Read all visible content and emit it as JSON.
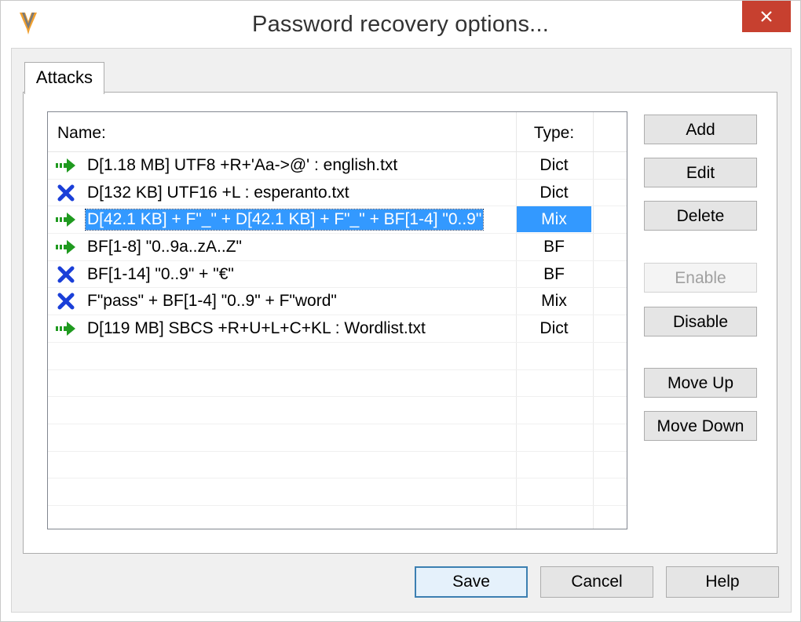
{
  "window": {
    "title": "Password recovery options..."
  },
  "tabs": [
    {
      "label": "Attacks"
    }
  ],
  "list": {
    "columns": {
      "name": "Name:",
      "type": "Type:"
    },
    "rows": [
      {
        "status": "enabled",
        "name": "D[1.18 MB]  UTF8 +R+'Aa->@' : english.txt",
        "type": "Dict",
        "selected": false
      },
      {
        "status": "disabled",
        "name": "D[132 KB]  UTF16 +L : esperanto.txt",
        "type": "Dict",
        "selected": false
      },
      {
        "status": "enabled",
        "name": "D[42.1 KB] + F\"_\" + D[42.1 KB] + F\"_\" + BF[1-4] \"0..9\"",
        "type": "Mix",
        "selected": true
      },
      {
        "status": "enabled",
        "name": "BF[1-8] \"0..9a..zA..Z\"",
        "type": "BF",
        "selected": false
      },
      {
        "status": "disabled",
        "name": "BF[1-14] \"0..9\" + \"€\"",
        "type": "BF",
        "selected": false
      },
      {
        "status": "disabled",
        "name": "F\"pass\" + BF[1-4] \"0..9\" + F\"word\"",
        "type": "Mix",
        "selected": false
      },
      {
        "status": "enabled",
        "name": "D[119 MB]  SBCS +R+U+L+C+KL : Wordlist.txt",
        "type": "Dict",
        "selected": false
      }
    ]
  },
  "side_buttons": {
    "add": "Add",
    "edit": "Edit",
    "delete": "Delete",
    "enable": "Enable",
    "disable": "Disable",
    "move_up": "Move Up",
    "move_down": "Move Down"
  },
  "footer_buttons": {
    "save": "Save",
    "cancel": "Cancel",
    "help": "Help"
  },
  "icons": {
    "enabled": "green-arrow-icon",
    "disabled": "blue-x-icon",
    "close": "close-icon",
    "app": "app-logo-icon"
  },
  "colors": {
    "selection": "#3399ff",
    "close_button": "#c7402f",
    "enabled_icon": "#1f9a1f",
    "disabled_icon": "#1a3fd8"
  }
}
